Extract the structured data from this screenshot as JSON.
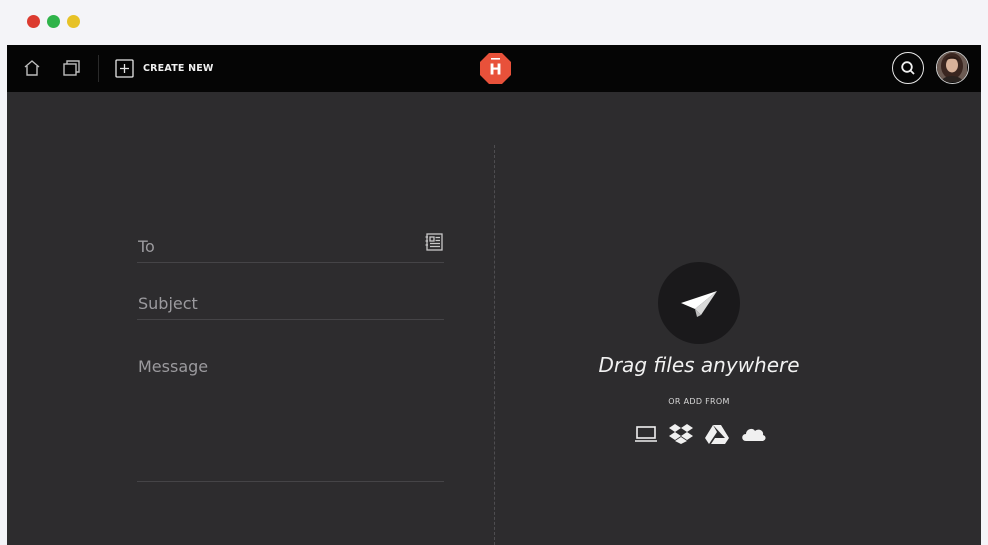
{
  "window_controls": [
    "close",
    "maximize",
    "minimize"
  ],
  "topbar": {
    "home_icon": "home-icon",
    "windows_icon": "windows-icon",
    "create_new_label": "CREATE NEW",
    "logo_letter": "H",
    "logo_color": "#e8513a",
    "search_icon": "search-icon",
    "avatar": "user-avatar"
  },
  "compose": {
    "to_placeholder": "To",
    "subject_placeholder": "Subject",
    "message_placeholder": "Message",
    "contacts_icon": "address-book-icon"
  },
  "upload": {
    "title": "Drag files anywhere",
    "add_from_label": "OR ADD FROM",
    "sources": [
      "computer",
      "dropbox",
      "google-drive",
      "onedrive"
    ]
  },
  "colors": {
    "background": "#2d2c2e",
    "topbar": "#050505",
    "accent": "#e8513a"
  }
}
